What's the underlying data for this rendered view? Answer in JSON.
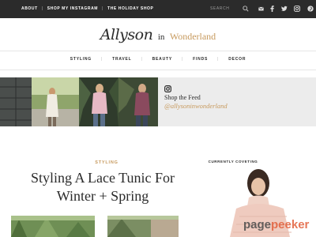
{
  "topbar": {
    "nav": [
      {
        "label": "ABOUT"
      },
      {
        "label": "SHOP MY INSTAGRAM"
      },
      {
        "label": "THE HOLIDAY SHOP"
      }
    ],
    "search_placeholder": "SEARCH",
    "social_icons": [
      "mail-icon",
      "facebook-icon",
      "twitter-icon",
      "instagram-icon",
      "pinterest-icon"
    ]
  },
  "logo": {
    "script": "Allyson",
    "in": "in",
    "wonderland": "Wonderland"
  },
  "main_nav": [
    {
      "label": "STYLING"
    },
    {
      "label": "TRAVEL"
    },
    {
      "label": "BEAUTY"
    },
    {
      "label": "FINDS"
    },
    {
      "label": "DECOR"
    }
  ],
  "feed": {
    "title": "Shop the Feed",
    "handle": "@allysoninwonderland"
  },
  "post": {
    "category": "STYLING",
    "title_line1": "Styling A Lace Tunic For",
    "title_line2": "Winter + Spring"
  },
  "sidebar": {
    "heading": "CURRENTLY COVETING"
  },
  "watermark": {
    "part1": "page",
    "part2": "peeker"
  },
  "colors": {
    "accent": "#c79a5e",
    "topbar": "#2b2b2b",
    "feed_bg": "#ececec"
  }
}
